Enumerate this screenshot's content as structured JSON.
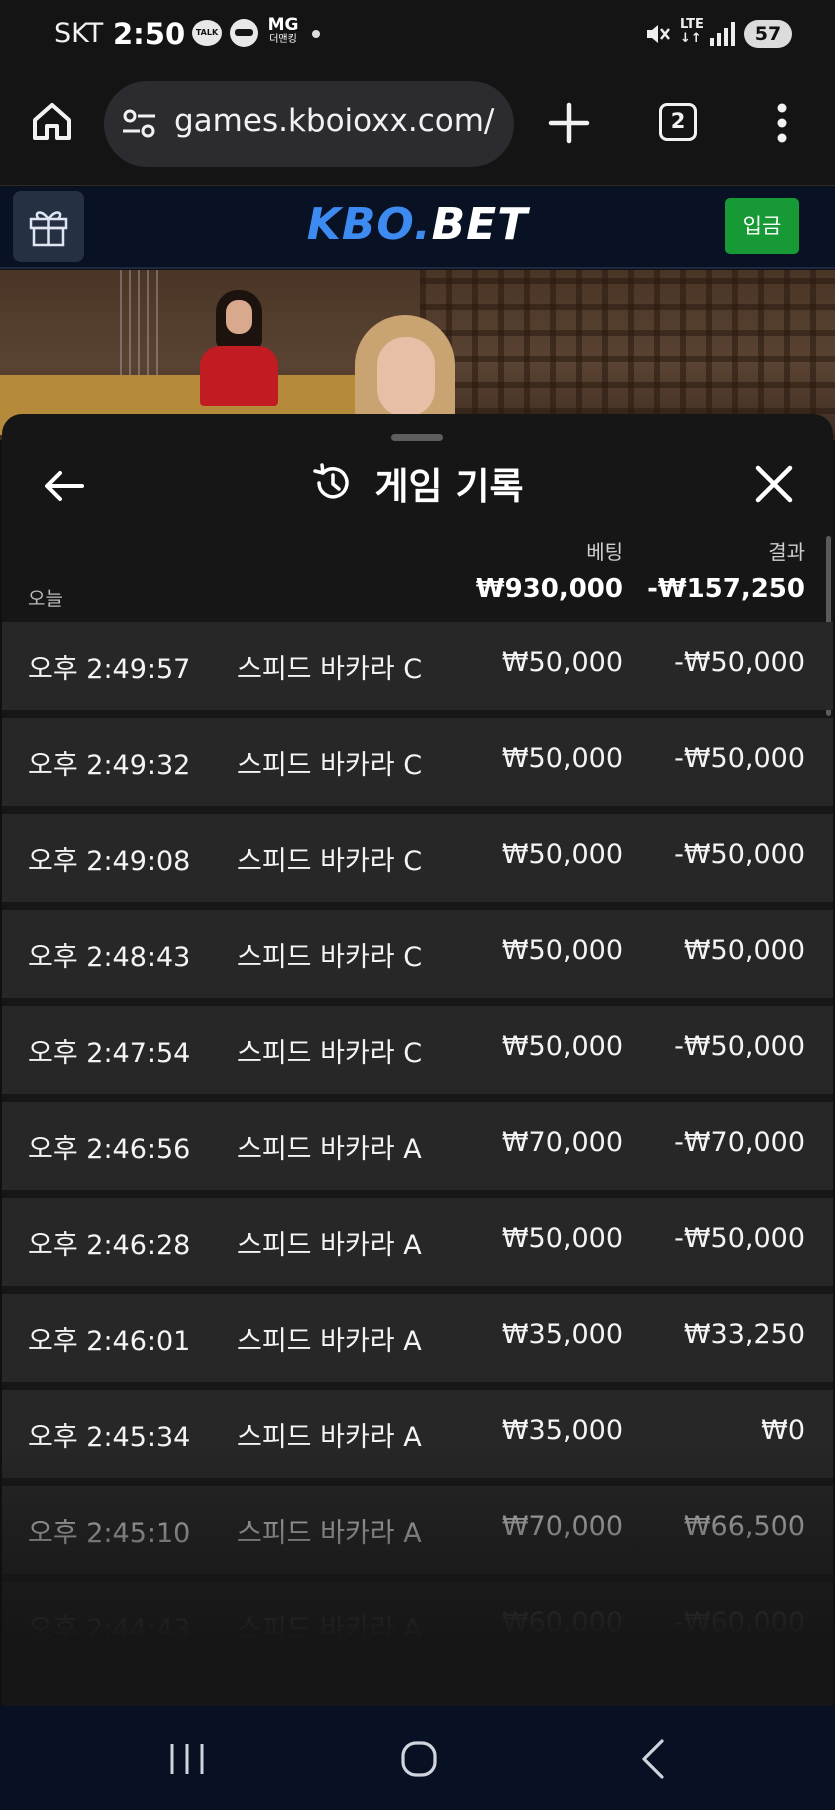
{
  "status_bar": {
    "carrier": "SKT",
    "time": "2:50",
    "talk_label": "TALK",
    "mg_label": "MG",
    "mg_sub": "더맨킹",
    "network": "LTE",
    "battery": "57"
  },
  "browser": {
    "url": "games.kboioxx.com/",
    "tab_count": "2"
  },
  "site": {
    "logo_kbo": "KBO.",
    "logo_bet": "BET",
    "deposit_label": "입금",
    "brand_color": "#3d8bf0",
    "deposit_color": "#179a36"
  },
  "modal": {
    "title": "게임 기록",
    "col_bet": "베팅",
    "col_result": "결과",
    "today_label": "오늘",
    "total_bet": "₩930,000",
    "total_result": "-₩157,250",
    "rows": [
      {
        "time": "오후 2:49:57",
        "game": "스피드 바카라 C",
        "bet": "₩50,000",
        "result": "-₩50,000"
      },
      {
        "time": "오후 2:49:32",
        "game": "스피드 바카라 C",
        "bet": "₩50,000",
        "result": "-₩50,000"
      },
      {
        "time": "오후 2:49:08",
        "game": "스피드 바카라 C",
        "bet": "₩50,000",
        "result": "-₩50,000"
      },
      {
        "time": "오후 2:48:43",
        "game": "스피드 바카라 C",
        "bet": "₩50,000",
        "result": "₩50,000"
      },
      {
        "time": "오후 2:47:54",
        "game": "스피드 바카라 C",
        "bet": "₩50,000",
        "result": "-₩50,000"
      },
      {
        "time": "오후 2:46:56",
        "game": "스피드 바카라 A",
        "bet": "₩70,000",
        "result": "-₩70,000"
      },
      {
        "time": "오후 2:46:28",
        "game": "스피드 바카라 A",
        "bet": "₩50,000",
        "result": "-₩50,000"
      },
      {
        "time": "오후 2:46:01",
        "game": "스피드 바카라 A",
        "bet": "₩35,000",
        "result": "₩33,250"
      },
      {
        "time": "오후 2:45:34",
        "game": "스피드 바카라 A",
        "bet": "₩35,000",
        "result": "₩0"
      },
      {
        "time": "오후 2:45:10",
        "game": "스피드 바카라 A",
        "bet": "₩70,000",
        "result": "₩66,500"
      },
      {
        "time": "오후 2:44:43",
        "game": "스피드 바카라 A",
        "bet": "₩60,000",
        "result": "-₩60,000"
      }
    ]
  },
  "icons": {
    "home": "home-icon",
    "site_settings": "tune-icon",
    "new_tab": "plus-icon",
    "menu": "more-vert-icon",
    "gift": "gift-icon",
    "back": "arrow-left-icon",
    "history": "history-icon",
    "close": "close-icon"
  }
}
